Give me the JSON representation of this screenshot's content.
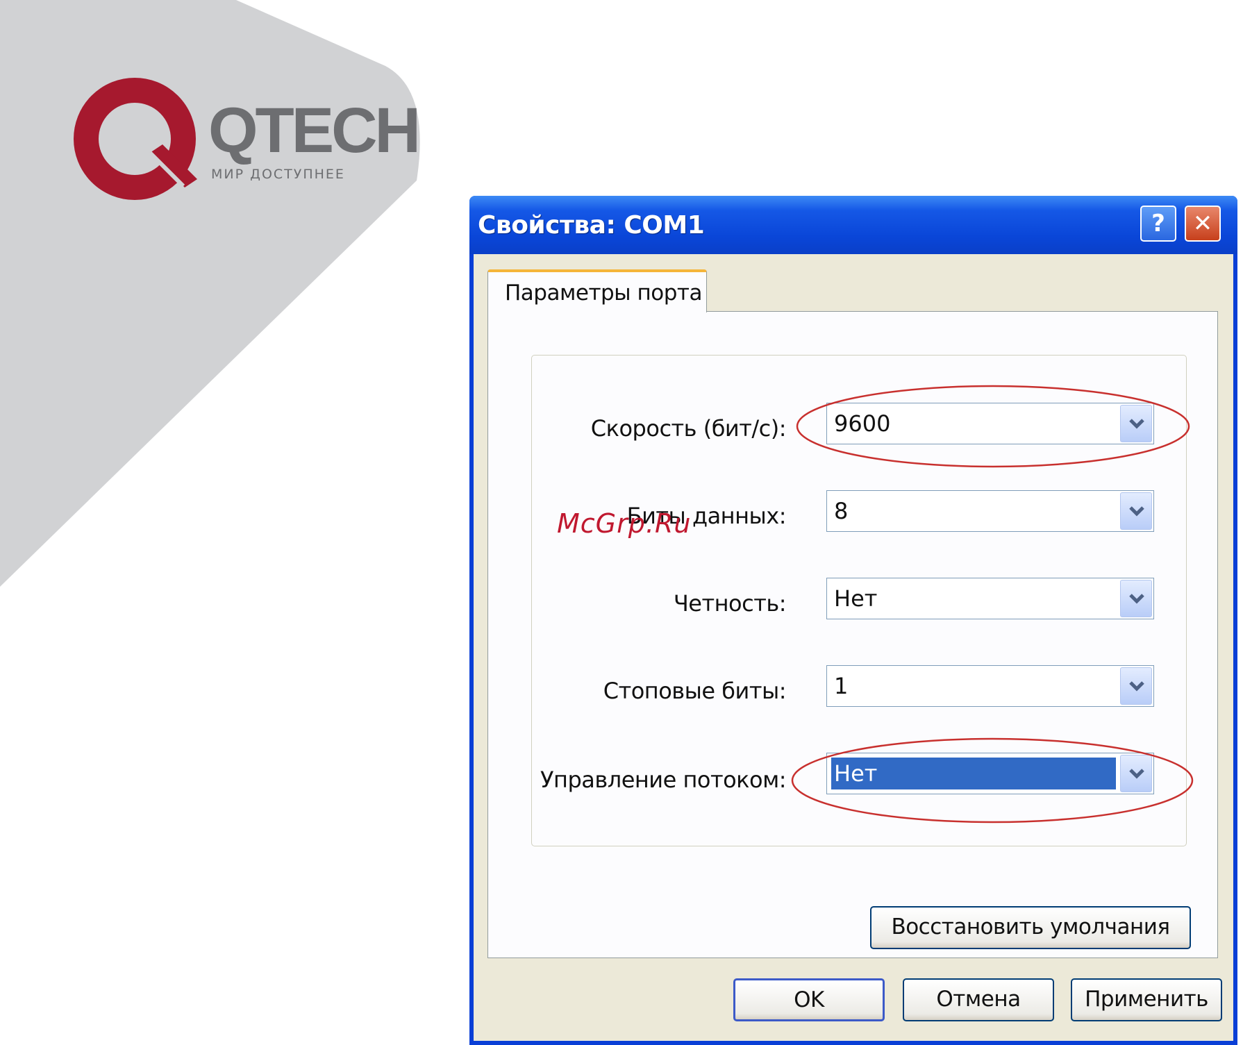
{
  "brand": {
    "name": "QTECH",
    "slogan": "МИР ДОСТУПНЕЕ",
    "mark_color": "#a6192e",
    "text_color": "#6d6e71",
    "shape_color": "#d1d2d4"
  },
  "dialog": {
    "title": "Свойства: COM1",
    "help_glyph": "?",
    "close_glyph": "✕",
    "tab_label": "Параметры порта",
    "fields": [
      {
        "label": "Скорость (бит/с):",
        "value": "9600"
      },
      {
        "label": "Биты данных:",
        "value": "8"
      },
      {
        "label": "Четность:",
        "value": "Нет"
      },
      {
        "label": "Стоповые биты:",
        "value": "1"
      },
      {
        "label": "Управление потоком:",
        "value": "Нет"
      }
    ],
    "restore_defaults_label": "Восстановить умолчания",
    "ok_label": "OK",
    "cancel_label": "Отмена",
    "apply_label": "Применить"
  },
  "watermark": "McGrp.Ru"
}
